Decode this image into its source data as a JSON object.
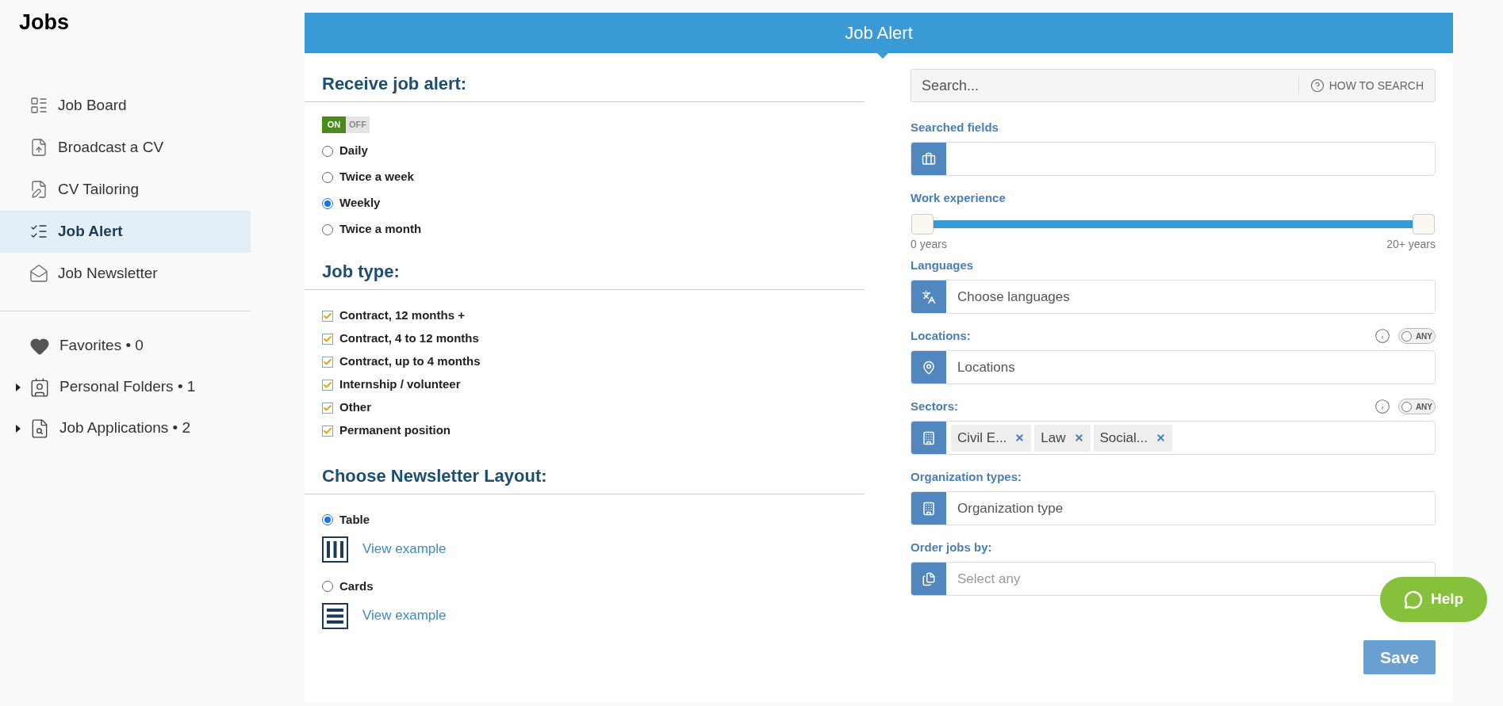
{
  "sidebar": {
    "title": "Jobs",
    "items": [
      {
        "label": "Job Board",
        "selected": false
      },
      {
        "label": "Broadcast a CV",
        "selected": false
      },
      {
        "label": "CV Tailoring",
        "selected": false
      },
      {
        "label": "Job Alert",
        "selected": true
      },
      {
        "label": "Job Newsletter",
        "selected": false
      }
    ],
    "collections": [
      {
        "label": "Favorites • 0",
        "expandable": false
      },
      {
        "label": "Personal Folders • 1",
        "expandable": true
      },
      {
        "label": "Job Applications • 2",
        "expandable": true
      }
    ]
  },
  "panel": {
    "title": "Job Alert",
    "alert": {
      "heading": "Receive job alert:",
      "toggle": {
        "on_label": "ON",
        "off_label": "OFF",
        "on": true
      },
      "frequencies": [
        {
          "label": "Daily",
          "selected": false
        },
        {
          "label": "Twice a week",
          "selected": false
        },
        {
          "label": "Weekly",
          "selected": true
        },
        {
          "label": "Twice a month",
          "selected": false
        }
      ]
    },
    "job_type": {
      "heading": "Job type:",
      "options": [
        {
          "label": "Contract, 12 months +",
          "checked": true
        },
        {
          "label": "Contract, 4 to 12 months",
          "checked": true
        },
        {
          "label": "Contract, up to 4 months",
          "checked": true
        },
        {
          "label": "Internship / volunteer",
          "checked": true
        },
        {
          "label": "Other",
          "checked": true
        },
        {
          "label": "Permanent position",
          "checked": true
        }
      ]
    },
    "layout": {
      "heading": "Choose Newsletter Layout:",
      "options": [
        {
          "label": "Table",
          "kind": "table",
          "selected": true,
          "link": "View example"
        },
        {
          "label": "Cards",
          "kind": "cards",
          "selected": false,
          "link": "View example"
        }
      ]
    },
    "search": {
      "placeholder": "Search...",
      "help": "HOW TO SEARCH"
    },
    "fields": [
      {
        "kind": "input",
        "label": "Searched fields"
      },
      {
        "kind": "range",
        "label": "Work experience",
        "thumbs": [
          {
            "level": 0
          },
          {
            "level": 1
          }
        ],
        "min_label": "0 years",
        "max_label": "20+ years"
      },
      {
        "kind": "input",
        "label": "Languages",
        "placeholder": "Choose languages"
      },
      {
        "kind": "input",
        "label": "Locations:",
        "placeholder": "Locations",
        "any": {
          "label": "ANY",
          "on": false
        }
      },
      {
        "kind": "input",
        "label": "Sectors:",
        "tags": [
          "Civil E...",
          "Law",
          "Social..."
        ],
        "any": {
          "label": "ANY",
          "on": false
        }
      },
      {
        "kind": "input",
        "label": "Organization types:",
        "placeholder": "Organization type"
      },
      {
        "kind": "input",
        "label": "Order jobs by:",
        "placeholder": "Select any",
        "faint": true
      }
    ],
    "save": "Save"
  },
  "help": "Help"
}
